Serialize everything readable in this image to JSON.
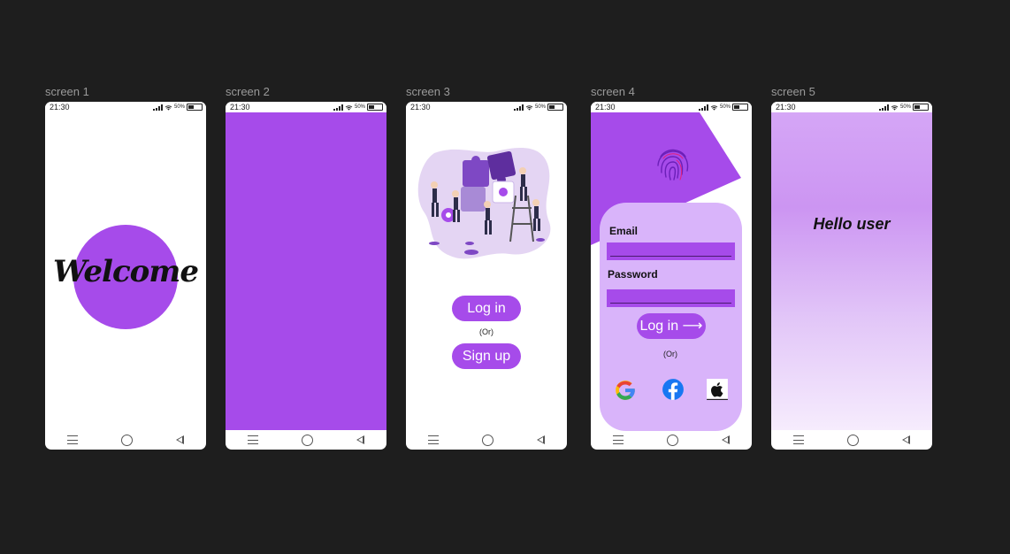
{
  "frames": [
    {
      "label": "screen 1"
    },
    {
      "label": "screen 2"
    },
    {
      "label": "screen 3"
    },
    {
      "label": "screen 4"
    },
    {
      "label": "screen 5"
    }
  ],
  "status_bar": {
    "time": "21:30",
    "battery": "50%"
  },
  "screen1": {
    "welcome": "Welcome"
  },
  "screen3": {
    "login_label": "Log in",
    "or_label": "(Or)",
    "signup_label": "Sign up"
  },
  "screen4": {
    "email_label": "Email",
    "password_label": "Password",
    "login_label": "Log in ⟶",
    "or_label": "(Or)",
    "social": [
      "google-icon",
      "facebook-icon",
      "apple-icon"
    ]
  },
  "screen5": {
    "greeting": "Hello user"
  },
  "colors": {
    "accent": "#a64bea",
    "card": "#d9b4fa",
    "background": "#1e1e1e"
  }
}
